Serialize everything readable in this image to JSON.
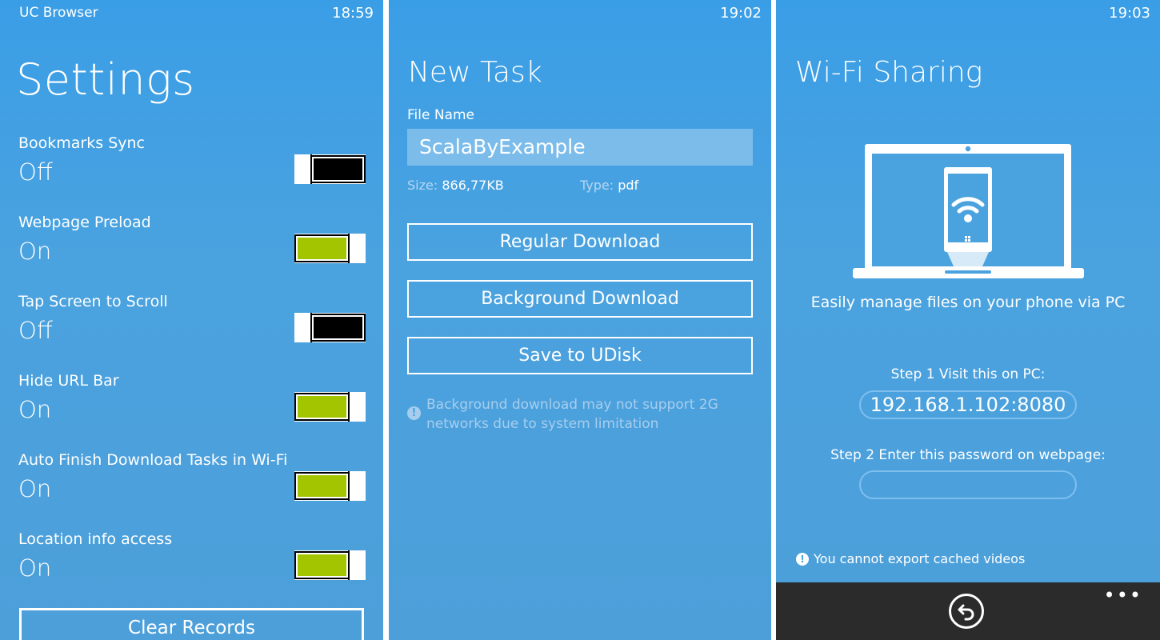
{
  "settings_screen": {
    "app_name": "UC Browser",
    "time": "18:59",
    "title": "Settings",
    "items": [
      {
        "label": "Bookmarks Sync",
        "value": "Off",
        "on": false
      },
      {
        "label": "Webpage Preload",
        "value": "On",
        "on": true
      },
      {
        "label": "Tap Screen to Scroll",
        "value": "Off",
        "on": false
      },
      {
        "label": "Hide URL Bar",
        "value": "On",
        "on": true
      },
      {
        "label": "Auto Finish Download Tasks in Wi-Fi",
        "value": "On",
        "on": true
      },
      {
        "label": "Location info access",
        "value": "On",
        "on": true
      }
    ],
    "clear_button": "Clear Records",
    "toggle_on_color": "#a3c500",
    "toggle_off_color": "#000000"
  },
  "new_task_screen": {
    "time": "19:02",
    "title": "New Task",
    "file_name_label": "File Name",
    "file_name_value": "ScalaByExample",
    "size_label": "Size:",
    "size_value": "866,77KB",
    "type_label": "Type:",
    "type_value": "pdf",
    "buttons": {
      "regular": "Regular Download",
      "background": "Background Download",
      "udisk": "Save to UDisk"
    },
    "notice": "Background download may not support 2G networks due to system limitation",
    "notice_icon": "info-icon"
  },
  "wifi_screen": {
    "time": "19:03",
    "title": "Wi-Fi Sharing",
    "caption": "Easily manage files on your phone via PC",
    "step1": "Step 1 Visit this on PC:",
    "address": "192.168.1.102:8080",
    "step2": "Step 2 Enter this password on webpage:",
    "password": "",
    "warning": "You cannot export cached videos",
    "appbar": {
      "back_icon": "back-icon",
      "more": "•••"
    }
  },
  "colors": {
    "background_blue": "#4aa2df",
    "appbar": "#2b2b2b",
    "accent_green": "#a3c500"
  }
}
